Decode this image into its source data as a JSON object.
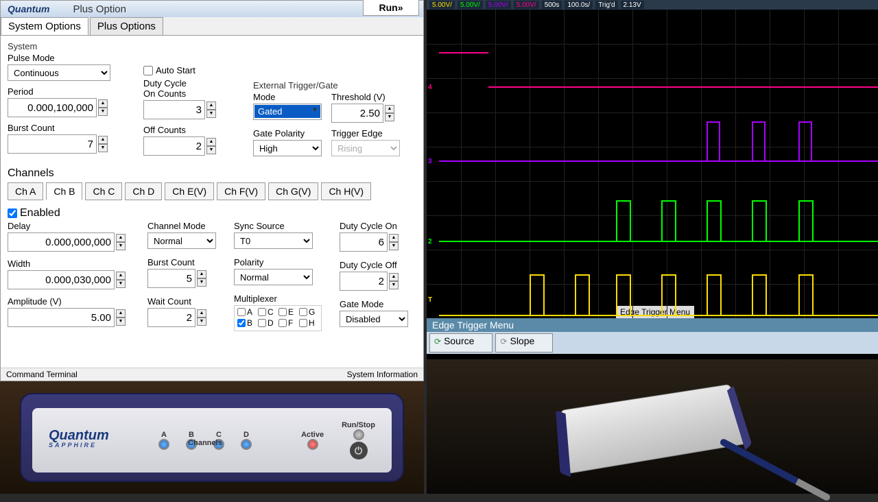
{
  "header": {
    "logo": "Quantum",
    "title": "Plus Option",
    "run": "Run»"
  },
  "tabs": {
    "system": "System Options",
    "plus": "Plus Options"
  },
  "system": {
    "label": "System",
    "pulse_mode": {
      "label": "Pulse Mode",
      "value": "Continuous"
    },
    "period": {
      "label": "Period",
      "value": "0.000,100,000"
    },
    "burst_count": {
      "label": "Burst Count",
      "value": "7"
    },
    "auto_start": {
      "label": "Auto Start",
      "checked": false
    },
    "duty_on": {
      "label": "Duty Cycle\nOn Counts",
      "value": "3"
    },
    "off_counts": {
      "label": "Off Counts",
      "value": "2"
    },
    "ext_trig": {
      "header": "External Trigger/Gate",
      "mode_label": "Mode",
      "mode": "Gated",
      "threshold_label": "Threshold (V)",
      "threshold": "2.50",
      "gate_pol_label": "Gate Polarity",
      "gate_pol": "High",
      "trig_edge_label": "Trigger Edge",
      "trig_edge": "Rising"
    }
  },
  "channels": {
    "header": "Channels",
    "tabs": [
      "Ch A",
      "Ch B",
      "Ch C",
      "Ch D",
      "Ch E(V)",
      "Ch F(V)",
      "Ch G(V)",
      "Ch H(V)"
    ],
    "active": "Ch B",
    "enabled_label": "Enabled",
    "enabled": true,
    "delay": {
      "label": "Delay",
      "value": "0.000,000,000"
    },
    "width": {
      "label": "Width",
      "value": "0.000,030,000"
    },
    "amplitude": {
      "label": "Amplitude (V)",
      "value": "5.00"
    },
    "channel_mode": {
      "label": "Channel Mode",
      "value": "Normal"
    },
    "burst": {
      "label": "Burst Count",
      "value": "5"
    },
    "wait": {
      "label": "Wait Count",
      "value": "2"
    },
    "sync": {
      "label": "Sync Source",
      "value": "T0"
    },
    "polarity": {
      "label": "Polarity",
      "value": "Normal"
    },
    "mux": {
      "label": "Multiplexer",
      "opts": [
        "A",
        "C",
        "E",
        "G",
        "B",
        "D",
        "F",
        "H"
      ],
      "checked": [
        "B"
      ]
    },
    "duty_on": {
      "label": "Duty Cycle On",
      "value": "6"
    },
    "duty_off": {
      "label": "Duty Cycle Off",
      "value": "2"
    },
    "gate_mode": {
      "label": "Gate Mode",
      "value": "Disabled"
    }
  },
  "footer": {
    "left": "Command Terminal",
    "right": "System Information"
  },
  "scope": {
    "badges": [
      "5.00V/",
      "5.00V/",
      "5.00V/",
      "5.00V/",
      "500s",
      "100.0s/",
      "Trig'd",
      "2.13V"
    ],
    "edge_menu": "Edge Trigger Menu",
    "source": "Source",
    "slope": "Slope",
    "tag": "Edge Trigger Menu",
    "markers": [
      "4",
      "3",
      "2",
      "T"
    ]
  },
  "device": {
    "brand": "Quantum",
    "model": "SAPPHIRE",
    "channels": [
      "A",
      "B",
      "C",
      "D"
    ],
    "ch_label": "Channels",
    "active": "Active",
    "runstop": "Run/Stop"
  }
}
